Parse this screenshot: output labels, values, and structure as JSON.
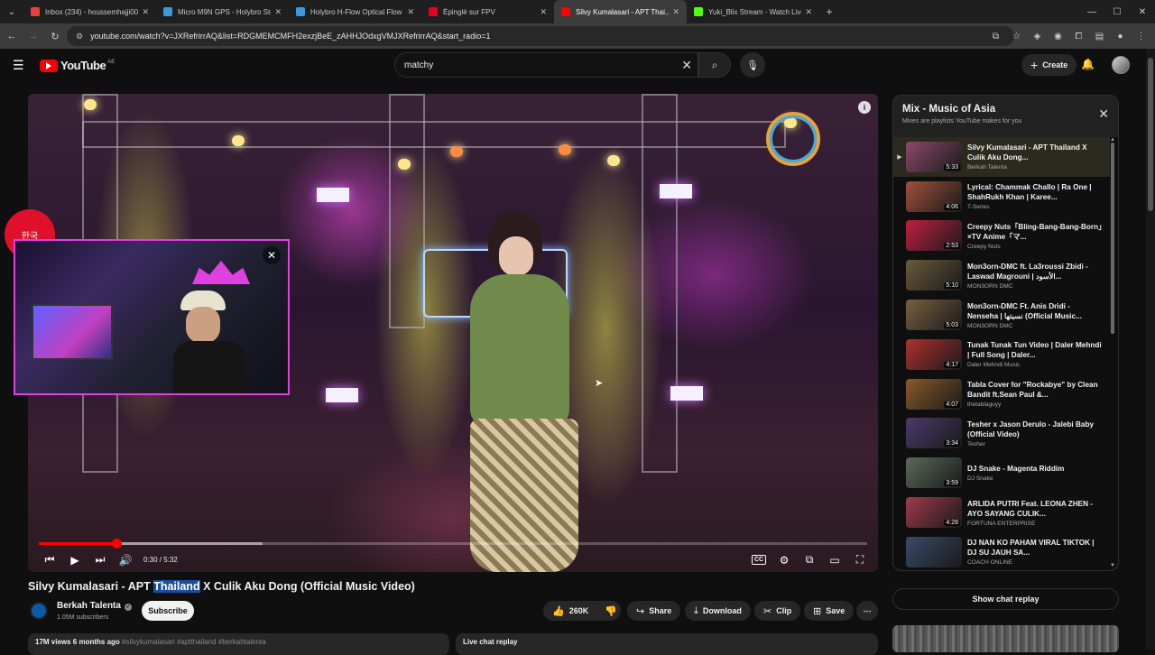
{
  "browser": {
    "tabs": [
      {
        "title": "Inbox (234) - houssemhajji00@...",
        "color": "#ea4335",
        "active": false
      },
      {
        "title": "Micro M9N GPS - Holybro Store",
        "color": "#3a9ad9",
        "active": false
      },
      {
        "title": "Holybro H-Flow Optical Flow an...",
        "color": "#3a9ad9",
        "active": false
      },
      {
        "title": "Épinglé sur FPV",
        "color": "#e60023",
        "active": false
      },
      {
        "title": "Silvy Kumalasari - APT Thai...",
        "color": "#ff0000",
        "active": true
      },
      {
        "title": "Yuki_Blix Stream - Watch Live o...",
        "color": "#53fc18",
        "active": false
      }
    ],
    "url": "youtube.com/watch?v=JXRefrirrAQ&list=RDGMEMCMFH2exzjBeE_zAHHJOdxgVMJXRefrirrAQ&start_radio=1"
  },
  "youtube": {
    "logo": "YouTube",
    "country": "AE",
    "search_value": "matchy",
    "create_label": "Create"
  },
  "player": {
    "time": "0:30 / 5:32",
    "progress_fraction": 0.094,
    "buffered_fraction": 0.27
  },
  "overlay": {
    "badge_text": "한국"
  },
  "video": {
    "title_before": "Silvy Kumalasari - APT ",
    "title_highlight": "Thailand",
    "title_after": " X Culik Aku Dong (Official Music Video)",
    "channel": "Berkah Talenta",
    "subscribers": "1.05M subscribers",
    "subscribe_label": "Subscribe",
    "likes": "260K",
    "share_label": "Share",
    "download_label": "Download",
    "clip_label": "Clip",
    "save_label": "Save",
    "views_time": "17M views  6 months ago",
    "hashtags": "#silvykumalasari #aptthailand #berkahtalenta",
    "live_chat_label": "Live chat replay"
  },
  "mix": {
    "title": "Mix - Music of Asia",
    "subtitle": "Mixes are playlists YouTube makes for you",
    "items": [
      {
        "title": "Silvy Kumalasari - APT Thailand X Culik Aku Dong...",
        "channel": "Berkah Talenta",
        "duration": "5:33",
        "thumb": "#8a4a6a"
      },
      {
        "title": "Lyrical: Chammak Challo | Ra One | ShahRukh Khan | Karee...",
        "channel": "T-Series",
        "duration": "4:06",
        "thumb": "#a0503a"
      },
      {
        "title": "Creepy Nuts「Bling-Bang-Bang-Born」×TV Anime「マ...",
        "channel": "Creepy Nuts",
        "duration": "2:53",
        "thumb": "#c02040"
      },
      {
        "title": "Mon3orn-DMC ft. La3roussi Zbidi - Laswad Magrouni | الأسود...",
        "channel": "MON3ORN DMC",
        "duration": "5:10",
        "thumb": "#6a5a3a"
      },
      {
        "title": "Mon3orn-DMC Ft. Anis Dridi - Nenseha | نسيتها (Official Music...",
        "channel": "MON3ORN DMC",
        "duration": "5:03",
        "thumb": "#7a6040"
      },
      {
        "title": "Tunak Tunak Tun Video | Daler Mehndi | Full Song | Daler...",
        "channel": "Daler Mehndi Music",
        "duration": "4:17",
        "thumb": "#b03030"
      },
      {
        "title": "Tabla Cover for \"Rockabye\" by Clean Bandit ft.Sean Paul &...",
        "channel": "thetablaguyy",
        "duration": "4:07",
        "thumb": "#8a5a2a"
      },
      {
        "title": "Tesher x Jason Derulo - Jalebi Baby (Official Video)",
        "channel": "Tesher",
        "duration": "3:34",
        "thumb": "#4a3a6a"
      },
      {
        "title": "DJ Snake - Magenta Riddim",
        "channel": "DJ Snake",
        "duration": "3:59",
        "thumb": "#5a6a5a"
      },
      {
        "title": "ARLIDA PUTRI Feat. LEONA ZHEN - AYO SAYANG CULIK...",
        "channel": "FORTUNA ENTERPRISE",
        "duration": "4:28",
        "thumb": "#a03a4a"
      },
      {
        "title": "DJ NAN KO PAHAM VIRAL TIKTOK | DJ SU JAUH SA...",
        "channel": "COACH ONLINE",
        "duration": "",
        "thumb": "#3a4a6a"
      }
    ],
    "show_chat_replay": "Show chat replay"
  },
  "colors": {
    "accent": "#ff0000",
    "background": "#0f0f0f",
    "overlay_border": "#e040e0"
  }
}
